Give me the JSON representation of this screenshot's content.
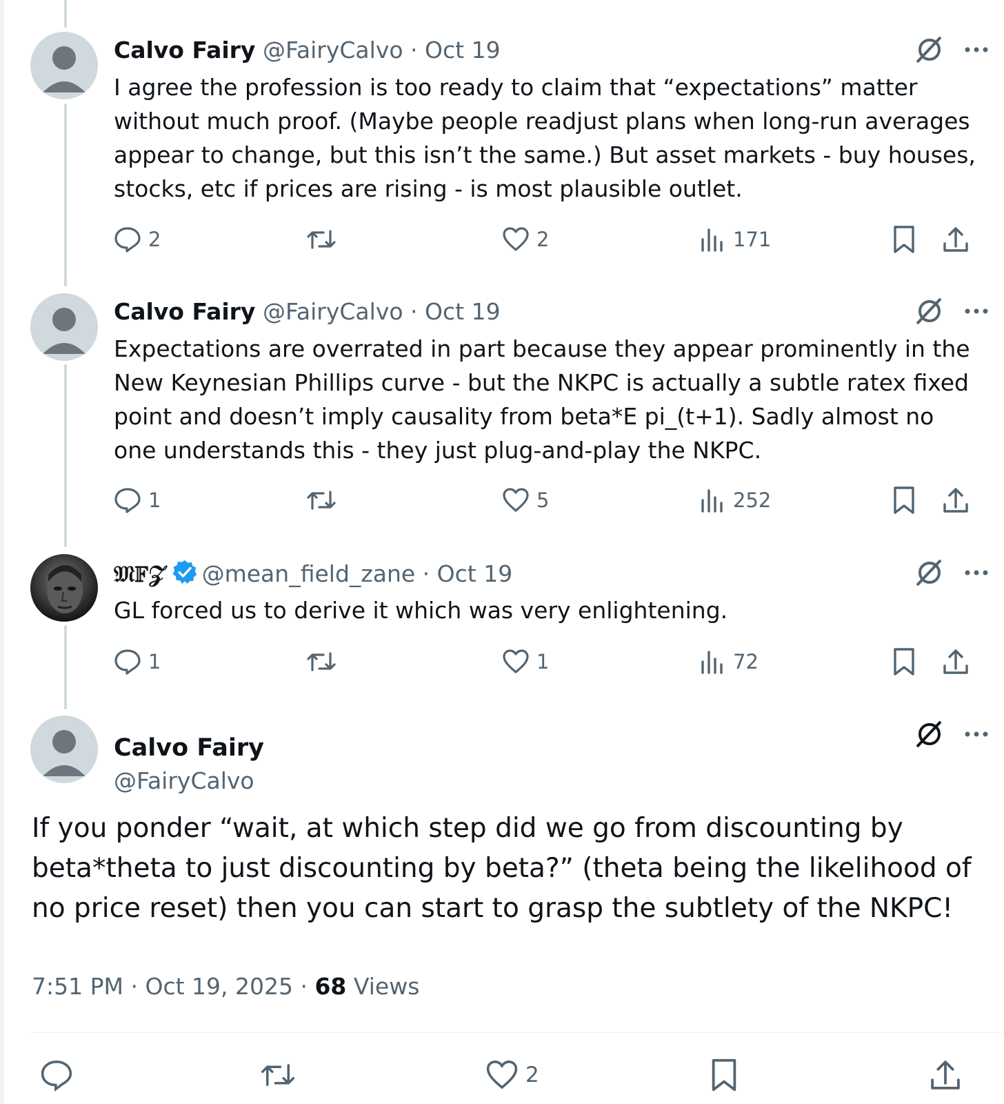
{
  "replies": [
    {
      "name": "Calvo Fairy",
      "handle": "@FairyCalvo",
      "separator": "·",
      "date": "Oct 19",
      "text": "I agree the profession is too ready to claim that “expectations” matter without much proof. (Maybe people readjust plans when long-run averages appear to change, but this isn’t the same.) But asset markets - buy houses, stocks, etc if prices are rising - is most plausible outlet.",
      "replies_count": "2",
      "retweets_count": "",
      "likes_count": "2",
      "views_count": "171"
    },
    {
      "name": "Calvo Fairy",
      "handle": "@FairyCalvo",
      "separator": "·",
      "date": "Oct 19",
      "text": "Expectations are overrated in part because they appear prominently in the New Keynesian Phillips curve - but the NKPC is actually a subtle ratex fixed point and doesn’t imply causality from beta*E pi_(t+1). Sadly almost no one understands this - they just plug-and-play the NKPC.",
      "replies_count": "1",
      "retweets_count": "",
      "likes_count": "5",
      "views_count": "252"
    },
    {
      "name": "𝔐𝔽𝒵",
      "handle": "@mean_field_zane",
      "separator": "·",
      "date": "Oct 19",
      "verified": true,
      "text": "GL forced us to derive it which was very enlightening.",
      "replies_count": "1",
      "retweets_count": "",
      "likes_count": "1",
      "views_count": "72"
    }
  ],
  "main_tweet": {
    "name": "Calvo Fairy",
    "handle": "@FairyCalvo",
    "text": "If you ponder “wait, at which step did we go from discounting by beta*theta to just discounting by beta?” (theta being the likelihood of no price reset) then you can start to grasp the subtlety of the NKPC!",
    "time": "7:51 PM",
    "separator": "·",
    "date": "Oct 19, 2025",
    "views_count": "68",
    "views_label": "Views",
    "likes_count": "2"
  },
  "colors": {
    "text": "#0f1419",
    "secondary": "#536471",
    "thread_line": "#cfd9de",
    "verified": "#1d9bf0"
  },
  "icons": [
    "reply-icon",
    "retweet-icon",
    "like-icon",
    "views-icon",
    "bookmark-icon",
    "share-icon",
    "grok-icon",
    "more-icon",
    "verified-badge-icon"
  ]
}
